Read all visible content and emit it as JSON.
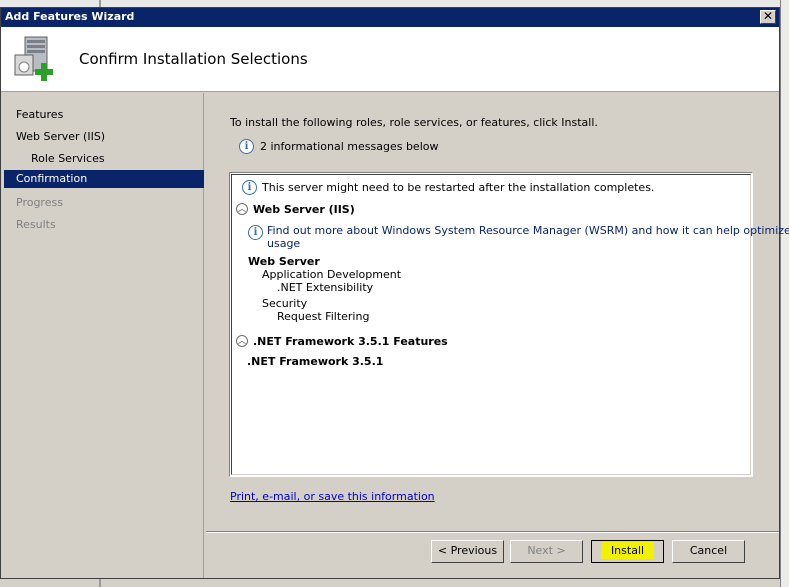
{
  "window": {
    "title": "Add Features Wizard",
    "close_glyph": "✕"
  },
  "header": {
    "title": "Confirm Installation Selections",
    "icon": "server-add-icon"
  },
  "sidebar": {
    "items": [
      {
        "label": "Features",
        "state": "normal"
      },
      {
        "label": "Web Server (IIS)",
        "state": "normal"
      },
      {
        "label": "Role Services",
        "state": "normal"
      },
      {
        "label": "Confirmation",
        "state": "active"
      },
      {
        "label": "Progress",
        "state": "disabled"
      },
      {
        "label": "Results",
        "state": "disabled"
      }
    ]
  },
  "main": {
    "intro": "To install the following roles, role services, or features, click Install.",
    "message_count": "2 informational messages below",
    "panel": {
      "restart_note": "This server might need to be restarted after the installation completes.",
      "section1": {
        "title": "Web Server (IIS)",
        "wsrm_link_line1": "Find out more about Windows System Resource Manager (WSRM) and how it can help optimize CPU",
        "wsrm_link_line2": "usage",
        "group": "Web Server",
        "sub1": "Application Development",
        "sub1_item": ".NET Extensibility",
        "sub2": "Security",
        "sub2_item": "Request Filtering"
      },
      "section2": {
        "title": ".NET Framework 3.5.1 Features",
        "item": ".NET Framework 3.5.1"
      }
    },
    "print_link": "Print, e-mail, or save this information"
  },
  "buttons": {
    "previous": "< Previous",
    "next": "Next >",
    "install": "Install",
    "cancel": "Cancel"
  },
  "colors": {
    "titlebar": "#0a246a",
    "active_nav": "#0a246a",
    "highlight": "#f2f200"
  }
}
